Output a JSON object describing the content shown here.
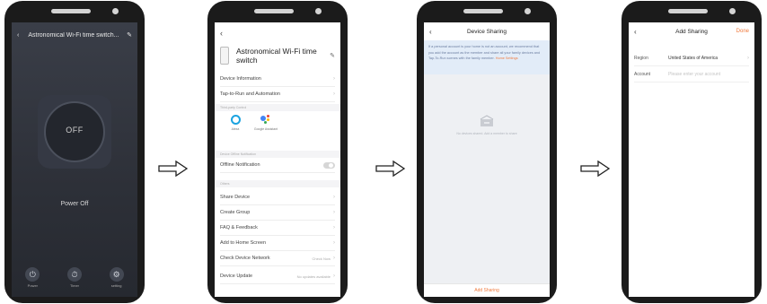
{
  "screen1": {
    "title": "Astronomical Wi-Fi time switch...",
    "power_label": "OFF",
    "state": "Power Off",
    "bottom": [
      {
        "icon": "power-icon",
        "label": "Power"
      },
      {
        "icon": "timer-icon",
        "label": "Timer"
      },
      {
        "icon": "settings-icon",
        "label": "setting"
      }
    ]
  },
  "screen2": {
    "device_name": "Astronomical Wi-Fi time switch",
    "rows_top": [
      "Device Information",
      "Tap-to-Run and Automation"
    ],
    "third_party_header": "Third-party Control",
    "assistants": [
      {
        "name": "Alexa"
      },
      {
        "name": "Google Assistant"
      }
    ],
    "offline_header": "Device Offline Notification",
    "offline_label": "Offline Notification",
    "others_header": "Others",
    "rows_bottom": [
      {
        "label": "Share Device",
        "value": ""
      },
      {
        "label": "Create Group",
        "value": ""
      },
      {
        "label": "FAQ & Feedback",
        "value": ""
      },
      {
        "label": "Add to Home Screen",
        "value": ""
      },
      {
        "label": "Check Device Network",
        "value": "Check Now"
      },
      {
        "label": "Device Update",
        "value": "No updates available"
      }
    ]
  },
  "screen3": {
    "title": "Device Sharing",
    "note": "If a personal account is your home is not an account, we recommend that you add the account as the member and share all your family devices and Tap-To-Run scenes with the family member.",
    "note_link": "Home Settings",
    "empty_text": "No devices shared. Add a member to share",
    "add_button": "Add Sharing"
  },
  "screen4": {
    "title": "Add Sharing",
    "done": "Done",
    "region_label": "Region",
    "region_value": "United States of America",
    "account_label": "Account",
    "account_placeholder": "Please enter your account"
  },
  "colors": {
    "accent": "#f07b3f",
    "phone_body": "#1b1b1b",
    "dark_screen": "#2f323b"
  }
}
